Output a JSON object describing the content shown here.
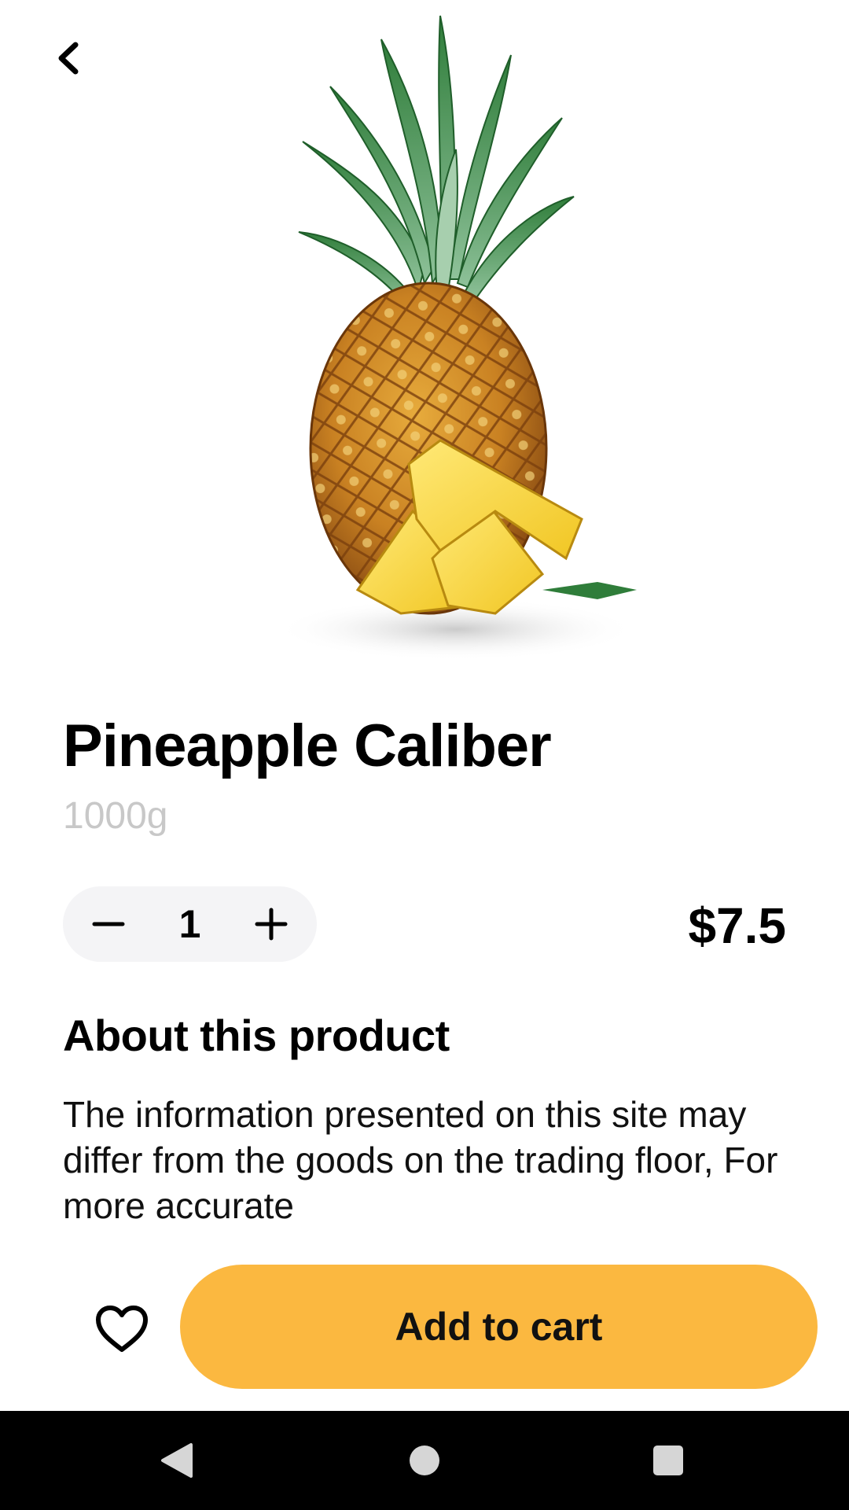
{
  "product": {
    "name": "Pineapple Caliber",
    "weight": "1000g",
    "quantity": "1",
    "price": "$7.5"
  },
  "about": {
    "heading": "About this product",
    "body": "The information presented on this site may differ from the goods on the trading floor, For more accurate"
  },
  "actions": {
    "add_to_cart_label": "Add to cart"
  },
  "icons": {
    "back": "chevron-left-icon",
    "decrease": "minus-icon",
    "increase": "plus-icon",
    "favorite": "heart-outline-icon",
    "nav_back": "triangle-back-icon",
    "nav_home": "circle-home-icon",
    "nav_recents": "square-recents-icon"
  },
  "colors": {
    "accent": "#fbb840",
    "stepper_bg": "#f4f4f6",
    "weight_text": "#c8c8c8",
    "navbar_bg": "#000000"
  }
}
